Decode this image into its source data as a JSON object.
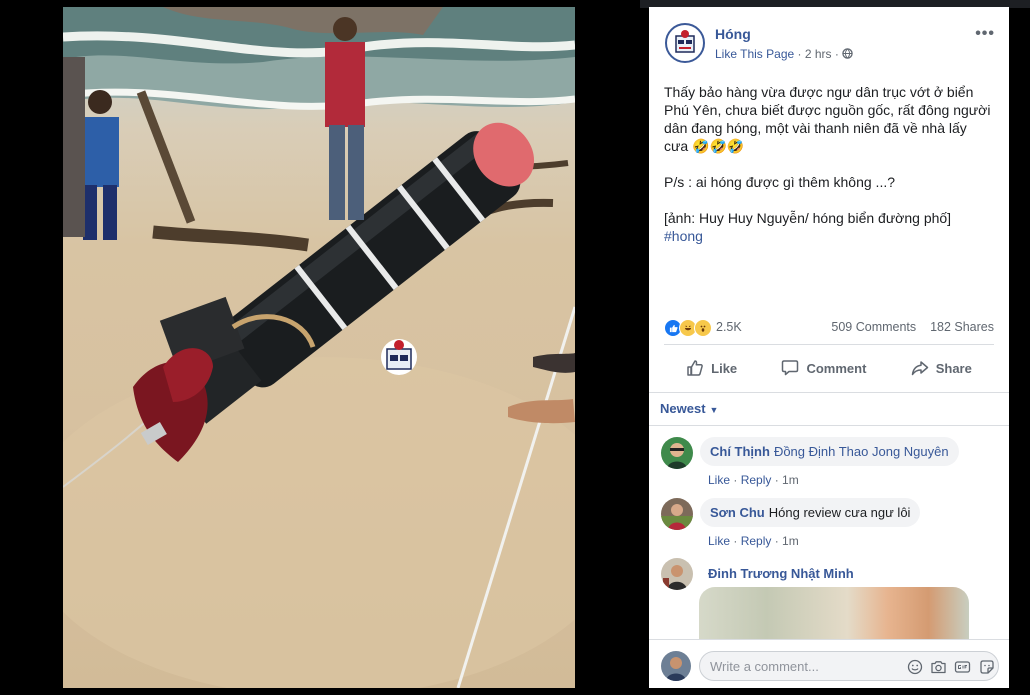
{
  "post": {
    "page_name": "Hóng",
    "like_page": "Like This Page",
    "time": "2 hrs",
    "dot": "·",
    "more": "•••",
    "body_paragraphs": [
      "Thấy bảo hàng vừa được ngư dân trục vớt ở biển Phú Yên, chưa biết được nguồn gốc, rất đông người dân đang hóng, một vài thanh niên đã về nhà lấy cưa 🤣🤣🤣",
      "P/s : ai hóng được gì thêm không ...?"
    ],
    "credit": "[ảnh: Huy Huy Nguyễn/ hóng biển đường phố]",
    "hashtag": "#hong"
  },
  "stats": {
    "reactions": [
      "like",
      "haha",
      "wow"
    ],
    "reaction_count": "2.5K",
    "comments": "509 Comments",
    "shares": "182 Shares"
  },
  "actions": {
    "like": "Like",
    "comment": "Comment",
    "share": "Share"
  },
  "sort": {
    "label": "Newest"
  },
  "comments": [
    {
      "name": "Chí Thịnh",
      "mention": "Đồng Định Thao Jong Nguyên",
      "text": "",
      "like": "Like",
      "reply": "Reply",
      "time": "1m"
    },
    {
      "name": "Sơn Chu",
      "mention": "",
      "text": "Hóng review cưa ngư lôi",
      "like": "Like",
      "reply": "Reply",
      "time": "1m"
    },
    {
      "name": "Đinh Trương Nhật Minh"
    }
  ],
  "composer": {
    "placeholder": "Write a comment..."
  },
  "colors": {
    "link": "#385898",
    "muted": "#606770",
    "bubble": "#f2f3f5"
  }
}
